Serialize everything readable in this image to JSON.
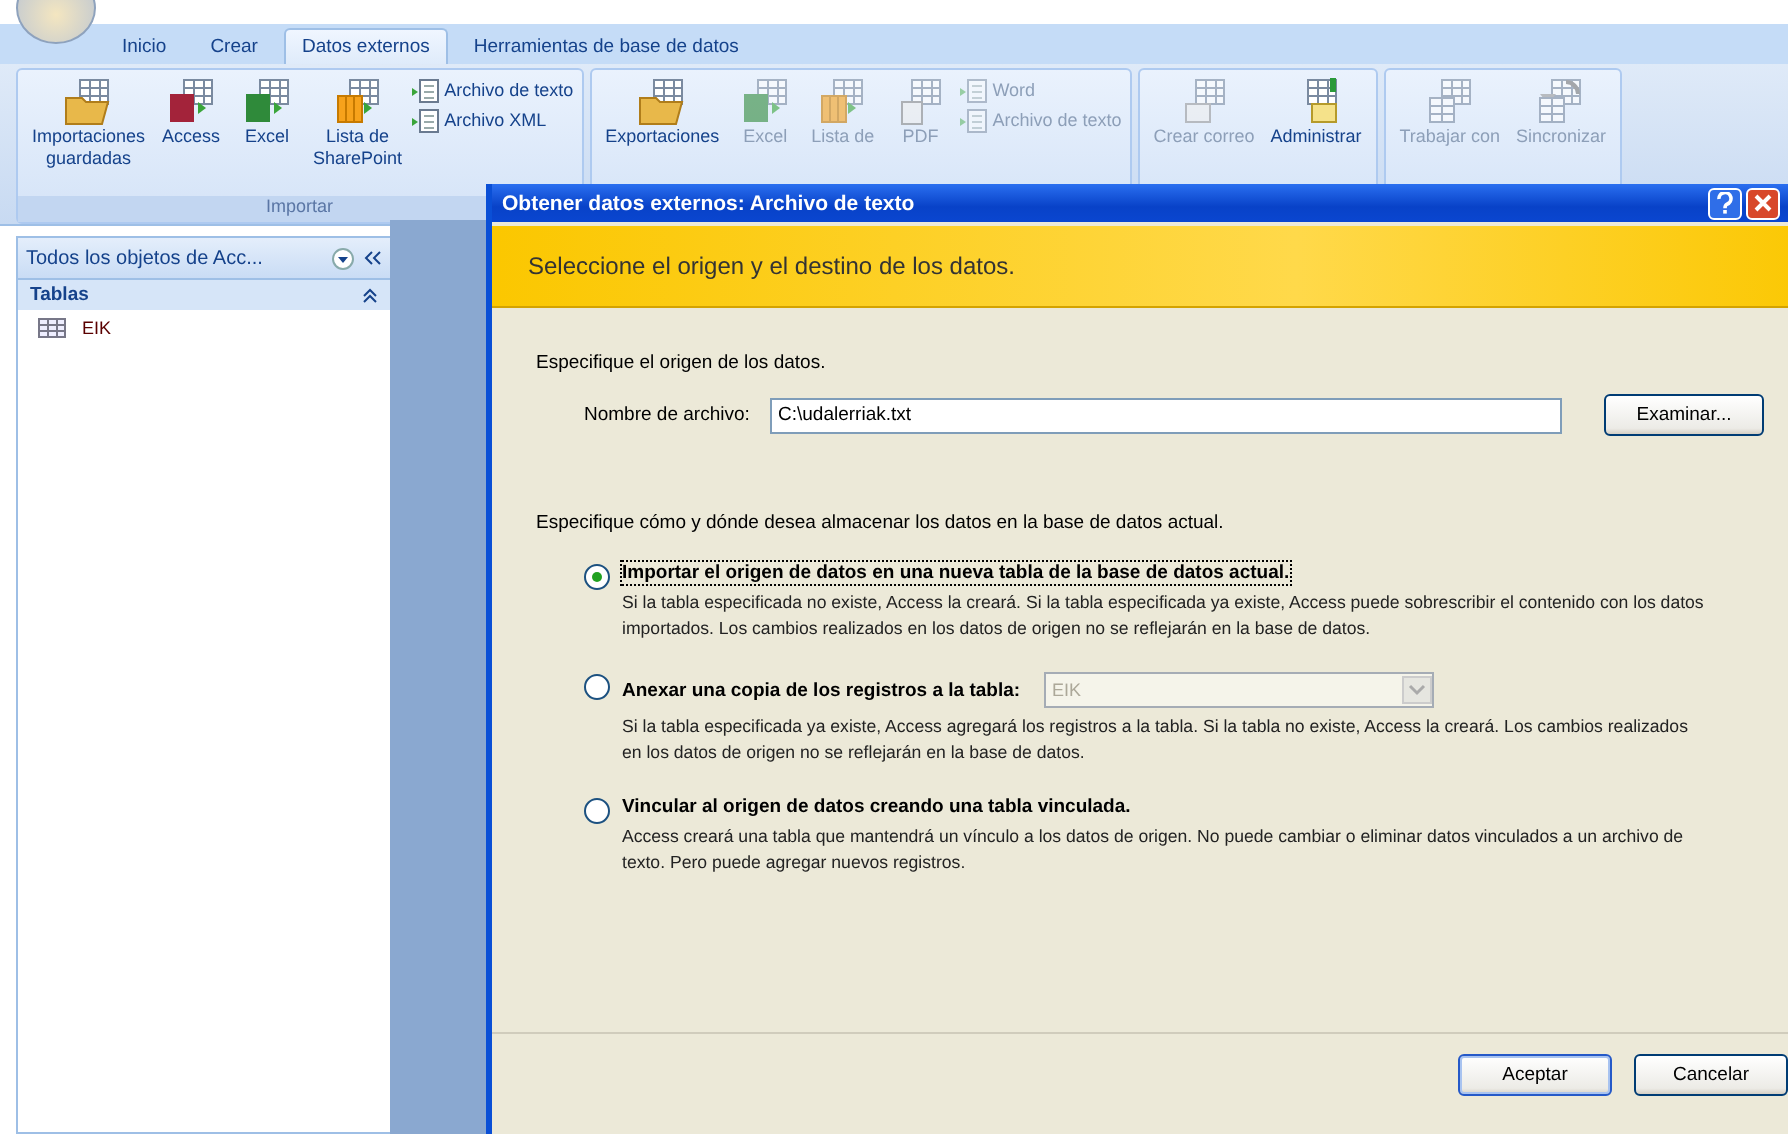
{
  "ribbon": {
    "tabs": [
      {
        "label": "Inicio",
        "selected": false
      },
      {
        "label": "Crear",
        "selected": false
      },
      {
        "label": "Datos externos",
        "selected": true
      },
      {
        "label": "Herramientas de base de datos",
        "selected": false
      }
    ],
    "groups": [
      {
        "label": "Importar",
        "large": [
          {
            "lines": [
              "Importaciones",
              "guardadas"
            ],
            "kind": "folder",
            "disabled": false
          },
          {
            "lines": [
              "Access"
            ],
            "kind": "access",
            "disabled": false
          },
          {
            "lines": [
              "Excel"
            ],
            "kind": "excel",
            "disabled": false
          },
          {
            "lines": [
              "Lista de",
              "SharePoint"
            ],
            "kind": "sharepoint",
            "disabled": false
          }
        ],
        "small": [
          {
            "label": "Archivo de texto",
            "disabled": false
          },
          {
            "label": "Archivo XML",
            "disabled": false
          }
        ]
      },
      {
        "large": [
          {
            "lines": [
              "Exportaciones"
            ],
            "kind": "folder",
            "disabled": false
          },
          {
            "lines": [
              "Excel"
            ],
            "kind": "excel",
            "disabled": true
          },
          {
            "lines": [
              "Lista de"
            ],
            "kind": "sharepoint",
            "disabled": true
          },
          {
            "lines": [
              "PDF"
            ],
            "kind": "pdf",
            "disabled": true
          }
        ],
        "small": [
          {
            "label": "Word",
            "disabled": true
          },
          {
            "label": "Archivo de texto",
            "disabled": true
          }
        ]
      },
      {
        "large": [
          {
            "lines": [
              "Crear correo"
            ],
            "kind": "mail",
            "disabled": true
          },
          {
            "lines": [
              "Administrar"
            ],
            "kind": "manage",
            "disabled": false
          }
        ]
      },
      {
        "large": [
          {
            "lines": [
              "Trabajar con"
            ],
            "kind": "table",
            "disabled": true
          },
          {
            "lines": [
              "Sincronizar"
            ],
            "kind": "sync",
            "disabled": true
          }
        ]
      }
    ]
  },
  "nav_pane": {
    "title": "Todos los objetos de Acc...",
    "section": "Tablas",
    "items": [
      "EIK"
    ]
  },
  "dialog": {
    "title": "Obtener datos externos: Archivo de texto",
    "banner": "Seleccione el origen y el destino de los datos.",
    "source_heading": "Especifique el origen de los datos.",
    "file_label": "Nombre de archivo:",
    "file_value": "C:\\udalerriak.txt",
    "browse_button": "Examinar...",
    "target_heading": "Especifique cómo y dónde desea almacenar los datos en la base de datos actual.",
    "options": [
      {
        "title": "Importar el origen de datos en una nueva tabla de la base de datos actual.",
        "selected": true,
        "description": "Si la tabla especificada no existe, Access la creará. Si la tabla especificada ya existe, Access puede sobrescribir el contenido con los datos importados. Los cambios realizados en los datos de origen no se reflejarán en la base de datos."
      },
      {
        "title": "Anexar una copia de los registros a la tabla:",
        "selected": false,
        "table_select": {
          "value": "EIK",
          "disabled": true
        },
        "description": "Si la tabla especificada ya existe, Access agregará los registros a la tabla. Si la tabla no existe, Access la creará. Los cambios realizados en los datos de origen no se reflejarán en la base de datos."
      },
      {
        "title": "Vincular al origen de datos creando una tabla vinculada.",
        "selected": false,
        "description": "Access creará una tabla que mantendrá un vínculo a los datos de origen. No puede cambiar o eliminar datos vinculados a un archivo de texto. Pero puede agregar nuevos registros."
      }
    ],
    "buttons": [
      {
        "label": "Aceptar",
        "default": true
      },
      {
        "label": "Cancelar",
        "default": false
      }
    ]
  }
}
